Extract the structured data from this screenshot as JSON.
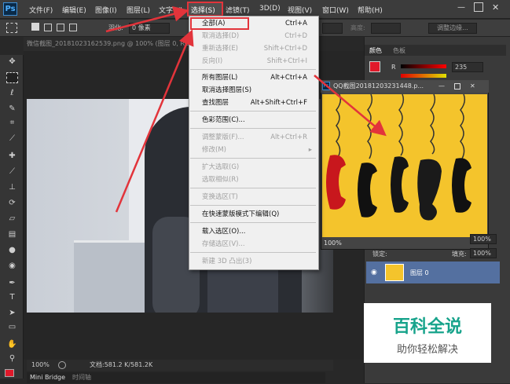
{
  "menubar": {
    "logo": "Ps",
    "items": [
      "文件(F)",
      "编辑(E)",
      "图像(I)",
      "图层(L)",
      "文字(Y)",
      "选择(S)",
      "滤镜(T)",
      "3D(D)",
      "视图(V)",
      "窗口(W)",
      "帮助(H)"
    ]
  },
  "options": {
    "feather_label": "羽化:",
    "feather_value": "0 像素",
    "height_label": "高度:",
    "refine_edge": "调整边缘..."
  },
  "document": {
    "tab_title": "微信截图_20181023162539.png @ 100% (图层 0, RGB/8)",
    "zoom": "100%",
    "doc_info": "文档:581.2 K/581.2K"
  },
  "bottom_tabs": [
    "Mini Bridge",
    "时间轴"
  ],
  "select_menu": {
    "items": [
      {
        "label": "全部(A)",
        "shortcut": "Ctrl+A",
        "enabled": true
      },
      {
        "label": "取消选择(D)",
        "shortcut": "Ctrl+D",
        "enabled": false
      },
      {
        "label": "重新选择(E)",
        "shortcut": "Shift+Ctrl+D",
        "enabled": false
      },
      {
        "label": "反向(I)",
        "shortcut": "Shift+Ctrl+I",
        "enabled": false
      },
      {
        "label": "所有图层(L)",
        "shortcut": "Alt+Ctrl+A",
        "enabled": true
      },
      {
        "label": "取消选择图层(S)",
        "shortcut": "",
        "enabled": true
      },
      {
        "label": "查找图层",
        "shortcut": "Alt+Shift+Ctrl+F",
        "enabled": true
      },
      {
        "label": "色彩范围(C)...",
        "shortcut": "",
        "enabled": true
      },
      {
        "label": "调整蒙版(F)...",
        "shortcut": "Alt+Ctrl+R",
        "enabled": false
      },
      {
        "label": "修改(M)",
        "shortcut": "▸",
        "enabled": false
      },
      {
        "label": "扩大选取(G)",
        "shortcut": "",
        "enabled": false
      },
      {
        "label": "选取相似(R)",
        "shortcut": "",
        "enabled": false
      },
      {
        "label": "变换选区(T)",
        "shortcut": "",
        "enabled": false
      },
      {
        "label": "在快速蒙版模式下编辑(Q)",
        "shortcut": "",
        "enabled": true
      },
      {
        "label": "载入选区(O)...",
        "shortcut": "",
        "enabled": true
      },
      {
        "label": "存储选区(V)...",
        "shortcut": "",
        "enabled": false
      },
      {
        "label": "新建 3D 凸出(3)",
        "shortcut": "",
        "enabled": false
      }
    ]
  },
  "color_panel": {
    "tab_color": "颜色",
    "tab_swatches": "色板",
    "r_label": "R",
    "r_value": "235"
  },
  "sub_window": {
    "title": "QQ截图20181203231448.p...",
    "zoom": "100%"
  },
  "layers_panel": {
    "lock_label": "锁定:",
    "fill_label": "填充:",
    "fill_value": "100%",
    "opacity_value": "100%",
    "layer_name": "图层 0"
  },
  "watermark": {
    "title": "百科全说",
    "subtitle": "助你轻松解决"
  },
  "colors": {
    "highlight": "#e2343b",
    "foreground": "#e0192a",
    "layer_selected": "#5470a0"
  }
}
